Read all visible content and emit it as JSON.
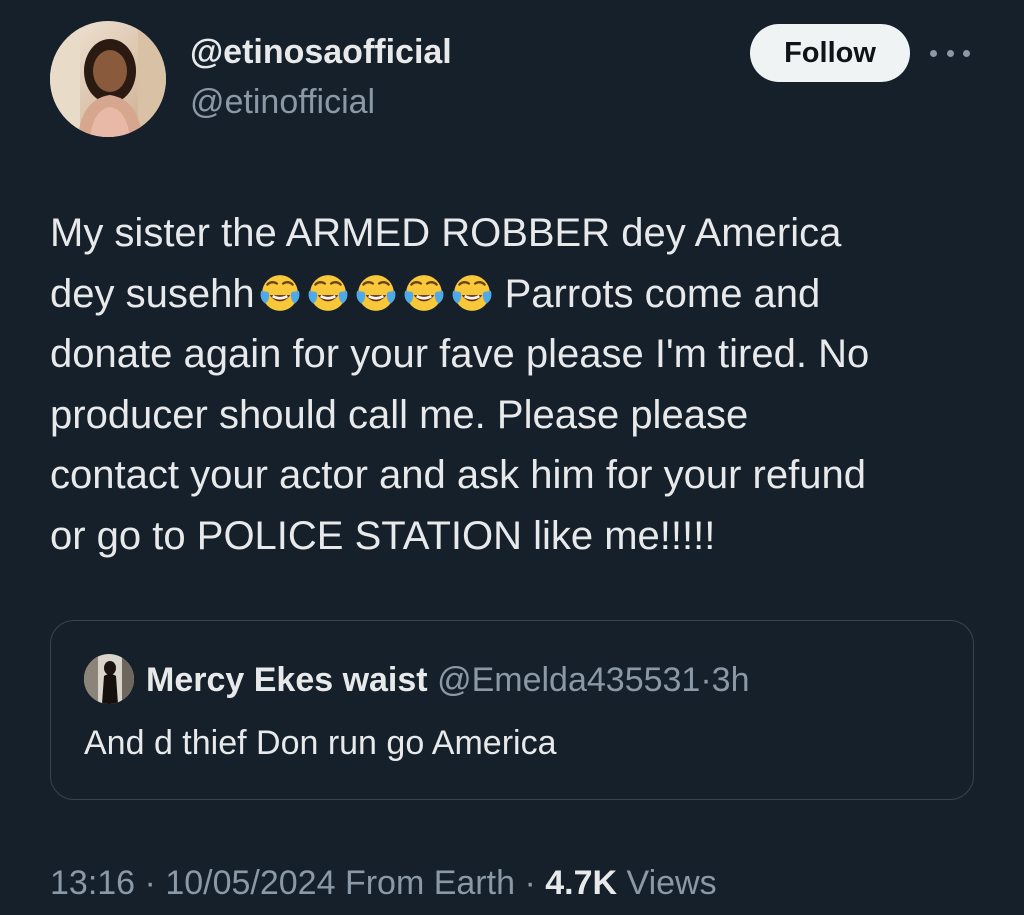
{
  "author": {
    "display_name": "@etinosaofficial",
    "handle": "@etinofficial",
    "avatar_icon": "profile-photo"
  },
  "actions": {
    "follow_label": "Follow",
    "more_icon": "more-horizontal-icon"
  },
  "tweet": {
    "lines": [
      "My sister the ARMED ROBBER dey America",
      "dey susehh",
      "Parrots come and",
      "donate again for your fave please I'm tired. No",
      "producer should call me. Please please",
      "contact your actor and ask him for your refund",
      "or go to POLICE STATION like me!!!!!"
    ],
    "emoji": "😂😂😂😂😂",
    "emoji_icon": "face-with-tears-of-joy-icon",
    "emoji_count": 5
  },
  "quote": {
    "name": "Mercy Ekes waist",
    "handle": "@Emelda435531",
    "separator": "·",
    "time": "3h",
    "text": "And d thief Don run go America"
  },
  "meta": {
    "time": "13:16",
    "sep1": "·",
    "date": "10/05/2024",
    "source": "From Earth",
    "sep2": "·",
    "views_count": "4.7K",
    "views_label": "Views"
  },
  "colors": {
    "background": "#15202b",
    "text_primary": "#e7e9ea",
    "text_secondary": "#8b98a5",
    "border": "#38444d",
    "follow_bg": "#eff3f4"
  }
}
